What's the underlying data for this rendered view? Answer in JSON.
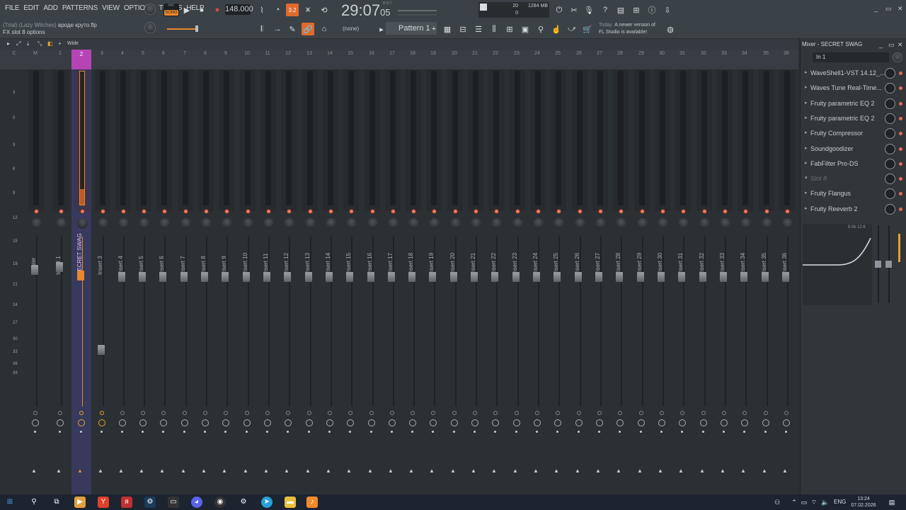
{
  "menu": [
    "FILE",
    "EDIT",
    "ADD",
    "PATTERNS",
    "VIEW",
    "OPTIONS",
    "TOOLS",
    "HELP"
  ],
  "project": {
    "trial": "(Trial) (Lazy Witches)",
    "file": "вроде круто.flp"
  },
  "hint": "FX slot 8 options",
  "transport": {
    "pat_label": "PAT",
    "song_label": "SONG",
    "tempo": "148.000",
    "time": "29:07",
    "time_small": "05",
    "bst": "B:S:T",
    "step": "3.2"
  },
  "cpu": {
    "mem": "1284 MB",
    "cpu": "20",
    "poly": "0"
  },
  "pattern": {
    "snap": "(none)",
    "name": "Pattern 1"
  },
  "news": {
    "date": "Today",
    "line1": "A newer version of",
    "line2": "FL Studio is available!"
  },
  "mixer_bar": {
    "label": "Wide"
  },
  "channel_numbers": [
    "C",
    "M",
    "1",
    "2",
    "3",
    "4",
    "5",
    "6",
    "7",
    "8",
    "9",
    "10",
    "11",
    "12",
    "13",
    "14",
    "15",
    "16",
    "17",
    "18",
    "19",
    "20",
    "21",
    "22",
    "23",
    "24",
    "25",
    "26",
    "27",
    "28",
    "29",
    "30",
    "31",
    "32",
    "33",
    "34",
    "35",
    "36"
  ],
  "strips": [
    "Master",
    "Insert 1",
    "SECRET SWAG",
    "Insert 3",
    "Insert 4",
    "Insert 5",
    "Insert 6",
    "Insert 7",
    "Insert 8",
    "Insert 9",
    "Insert 10",
    "Insert 11",
    "Insert 12",
    "Insert 13",
    "Insert 14",
    "Insert 15",
    "Insert 16",
    "Insert 17",
    "Insert 18",
    "Insert 19",
    "Insert 20",
    "Insert 21",
    "Insert 22",
    "Insert 23",
    "Insert 24",
    "Insert 25",
    "Insert 26",
    "Insert 27",
    "Insert 28",
    "Insert 29",
    "Insert 30",
    "Insert 31",
    "Insert 32",
    "Insert 33",
    "Insert 34",
    "Insert 35",
    "Insert 36"
  ],
  "db_scale": [
    "3",
    "0",
    "3",
    "6",
    "9",
    "12",
    "15",
    "18",
    "21",
    "24",
    "27",
    "30",
    "33",
    "36",
    "39"
  ],
  "panel": {
    "title": "Mixer - SECRET SWAG",
    "input": "In 1",
    "slots": [
      "WaveShell1-VST 14.12_...",
      "Waves Tune Real-Time...",
      "Fruity parametric EQ 2",
      "Fruity parametric EQ 2",
      "Fruity Compressor",
      "Soundgoodizer",
      "FabFilter Pro-DS",
      "Slot 8",
      "Fruity Flangus",
      "Fruity Reeverb 2"
    ],
    "eq_value": "8.0k 12.6"
  },
  "taskbar": {
    "lang": "ENG",
    "time": "13:24",
    "date": "07.02.2026"
  },
  "colors": {
    "accent_orange": "#f08a2c",
    "selected_header": "#b545b5",
    "selected_strip": "#373a5c",
    "led": "#f07a5c"
  }
}
